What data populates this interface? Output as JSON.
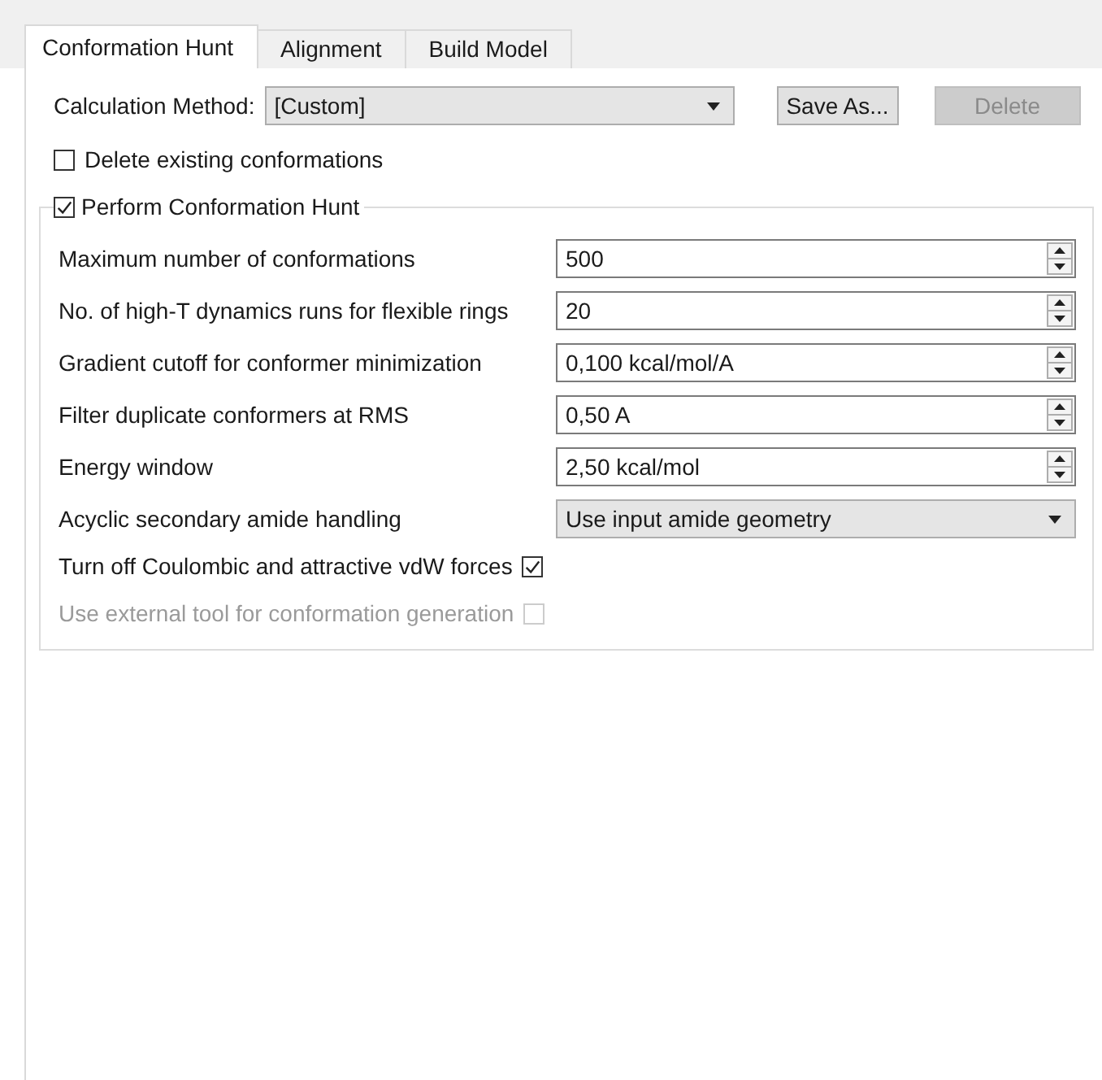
{
  "tabs": [
    {
      "label": "Conformation Hunt",
      "selected": true
    },
    {
      "label": "Alignment",
      "selected": false
    },
    {
      "label": "Build Model",
      "selected": false
    }
  ],
  "calculation_method": {
    "label": "Calculation Method:",
    "value": "[Custom]"
  },
  "buttons": [
    {
      "label": "Save As...",
      "disabled": false
    },
    {
      "label": "Delete",
      "disabled": true
    }
  ],
  "delete_existing": {
    "label": "Delete existing conformations",
    "checked": false
  },
  "group": {
    "label": "Perform Conformation Hunt",
    "checked": true,
    "settings": [
      {
        "kind": "spin",
        "label": "Maximum number of conformations",
        "value": "500"
      },
      {
        "kind": "spin",
        "label": "No. of high-T dynamics runs for flexible rings",
        "value": "20"
      },
      {
        "kind": "spin",
        "label": "Gradient cutoff for conformer minimization",
        "value": "0,100 kcal/mol/A"
      },
      {
        "kind": "spin",
        "label": "Filter duplicate conformers at RMS",
        "value": "0,50 A"
      },
      {
        "kind": "spin",
        "label": "Energy window",
        "value": "2,50 kcal/mol"
      },
      {
        "kind": "combo",
        "label": "Acyclic secondary amide handling",
        "value": "Use input amide geometry"
      },
      {
        "kind": "check",
        "label": "Turn off Coulombic and attractive vdW forces",
        "checked": true,
        "disabled": false
      },
      {
        "kind": "check",
        "label": "Use external tool for conformation generation",
        "checked": false,
        "disabled": true
      }
    ]
  }
}
